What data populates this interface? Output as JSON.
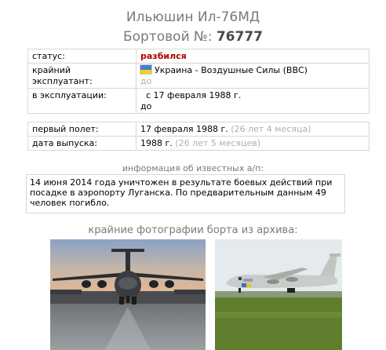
{
  "title": {
    "model": "Ильюшин Ил-76МД",
    "board_label": "Бортовой №:",
    "board_number": "76777"
  },
  "status": {
    "label": "статус:",
    "value": "разбился"
  },
  "operator": {
    "label": "крайний эксплуатант:",
    "value": "Украина - Воздушные Силы (ВВС)",
    "until": "до",
    "flag_colors": [
      "#3f7fd4",
      "#f2d21a"
    ]
  },
  "in_service": {
    "label": "в эксплуатации:",
    "from": "с 17 февраля 1988 г.",
    "until": "до"
  },
  "first_flight": {
    "label": "первый полет:",
    "value": "17 февраля 1988 г.",
    "age": "(26 лет 4 месяца)"
  },
  "built": {
    "label": "дата выпуска:",
    "value": "1988 г.",
    "age": "(26 лет 5 месяцев)"
  },
  "known_info": {
    "heading": "информация об известных а/п:",
    "text": "14 июня 2014 года уничтожен в результате боевых действий при посадке в аэропорту Луганска. По предварительным данным 49 человек погибло."
  },
  "photos": {
    "heading": "крайние фотографии борта из архива:"
  }
}
